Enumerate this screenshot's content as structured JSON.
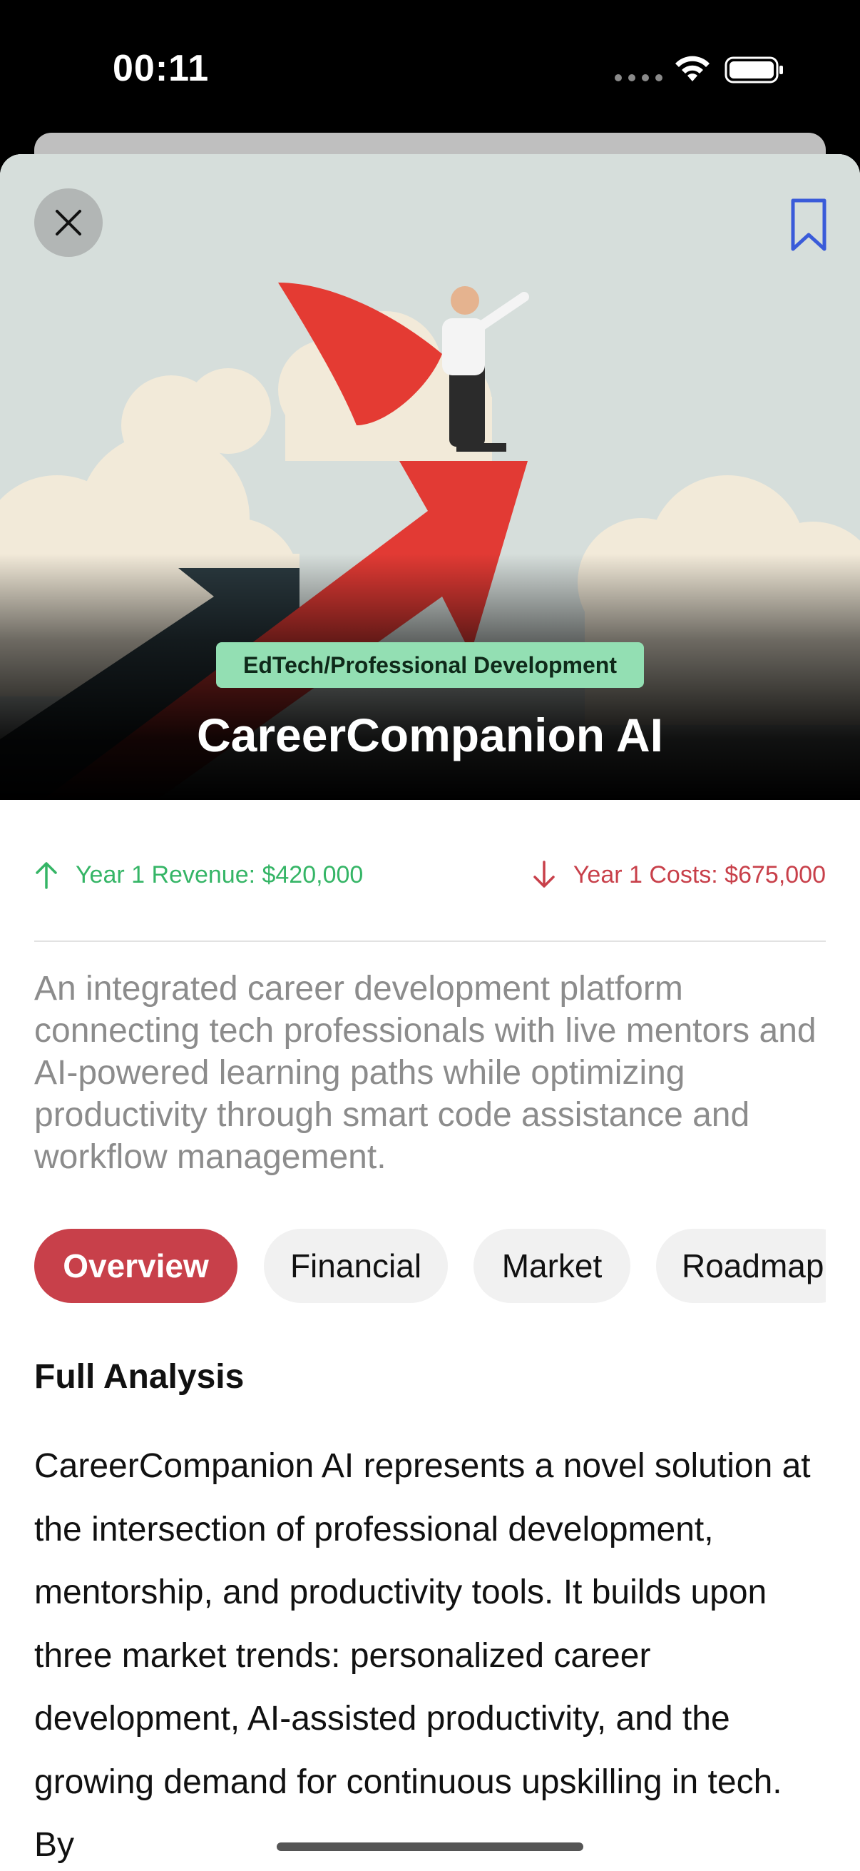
{
  "status_bar": {
    "time": "00:11"
  },
  "hero": {
    "category": "EdTech/Professional Development",
    "title": "CareerCompanion AI"
  },
  "metrics": {
    "revenue": "Year 1 Revenue: $420,000",
    "costs": "Year 1 Costs: $675,000"
  },
  "description": "An integrated career development platform connecting tech professionals with live mentors and AI-powered learning paths while optimizing productivity through smart code assistance and workflow management.",
  "tabs": [
    {
      "label": "Overview",
      "active": true
    },
    {
      "label": "Financial",
      "active": false
    },
    {
      "label": "Market",
      "active": false
    },
    {
      "label": "Roadmap",
      "active": false
    }
  ],
  "analysis": {
    "heading": "Full Analysis",
    "body": "CareerCompanion AI represents a novel solution at the intersection of professional development, mentorship, and productivity tools. It builds upon three market trends: personalized career development, AI-assisted productivity, and the growing demand for continuous upskilling in tech. By"
  },
  "colors": {
    "accent": "#c8404a",
    "positive": "#35b566",
    "badge": "#93dfb3",
    "bookmark": "#3a5bd9"
  }
}
